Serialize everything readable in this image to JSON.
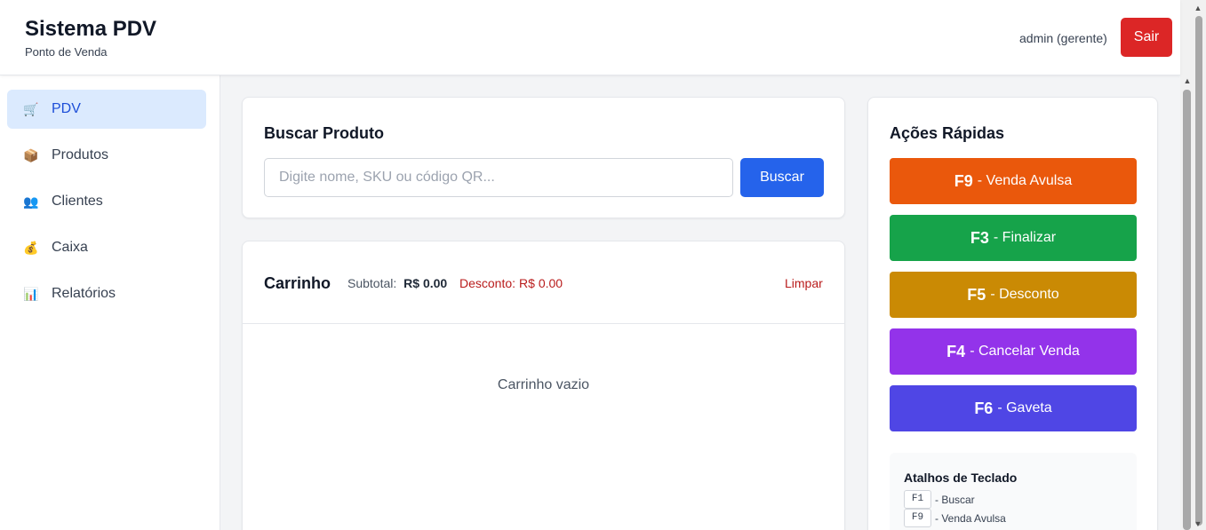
{
  "header": {
    "title": "Sistema PDV",
    "subtitle": "Ponto de Venda",
    "user": "admin (gerente)",
    "logout_label": "Sair"
  },
  "sidebar": {
    "items": [
      {
        "label": "PDV",
        "icon": "shopping-cart-icon",
        "glyph": "🛒",
        "active": true
      },
      {
        "label": "Produtos",
        "icon": "package-icon",
        "glyph": "📦",
        "active": false
      },
      {
        "label": "Clientes",
        "icon": "users-icon",
        "glyph": "👥",
        "active": false
      },
      {
        "label": "Caixa",
        "icon": "money-bag-icon",
        "glyph": "💰",
        "active": false
      },
      {
        "label": "Relatórios",
        "icon": "bar-chart-icon",
        "glyph": "📊",
        "active": false
      }
    ]
  },
  "search": {
    "title": "Buscar Produto",
    "placeholder": "Digite nome, SKU ou código QR...",
    "value": "",
    "button_label": "Buscar"
  },
  "cart": {
    "title": "Carrinho",
    "subtotal_label": "Subtotal:",
    "subtotal_value": "R$ 0.00",
    "discount_label": "Desconto:",
    "discount_value": "R$ 0.00",
    "clear_label": "Limpar",
    "empty_message": "Carrinho vazio"
  },
  "quick_actions": {
    "title": "Ações Rápidas",
    "buttons": [
      {
        "key": "F9",
        "label": "- Venda Avulsa",
        "color": "#ea580c"
      },
      {
        "key": "F3",
        "label": "- Finalizar",
        "color": "#16a34a"
      },
      {
        "key": "F5",
        "label": "- Desconto",
        "color": "#ca8a04"
      },
      {
        "key": "F4",
        "label": "- Cancelar Venda",
        "color": "#9333ea"
      },
      {
        "key": "F6",
        "label": "- Gaveta",
        "color": "#4f46e5"
      }
    ]
  },
  "shortcuts": {
    "title": "Atalhos de Teclado",
    "items": [
      {
        "key": "F1",
        "label": "- Buscar"
      },
      {
        "key": "F9",
        "label": "- Venda Avulsa"
      }
    ]
  },
  "colors": {
    "primary": "#2563eb",
    "danger": "#dc2626",
    "active_nav_bg": "#dbeafe"
  }
}
